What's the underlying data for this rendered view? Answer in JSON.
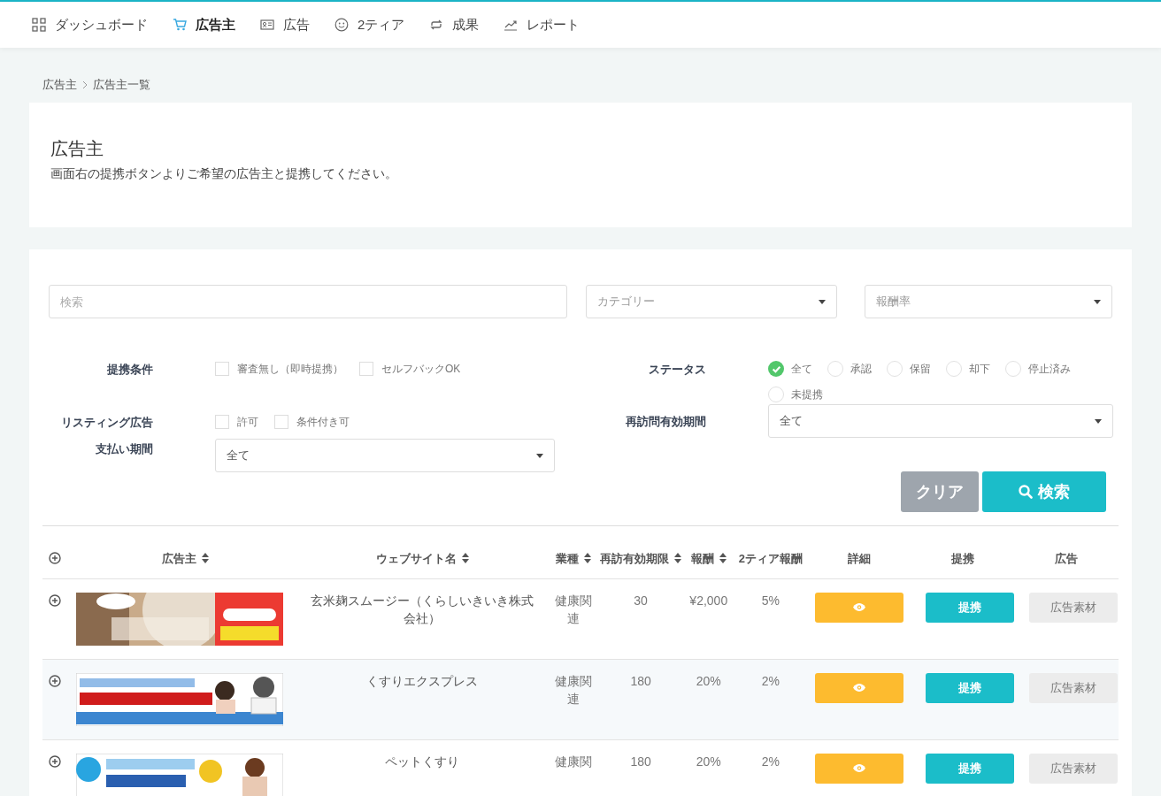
{
  "nav": [
    {
      "label": "ダッシュボード",
      "selected": false
    },
    {
      "label": "広告主",
      "selected": true
    },
    {
      "label": "広告",
      "selected": false
    },
    {
      "label": "2ティア",
      "selected": false
    },
    {
      "label": "成果",
      "selected": false
    },
    {
      "label": "レポート",
      "selected": false
    }
  ],
  "breadcrumb": [
    "広告主",
    "広告主一覧"
  ],
  "header": {
    "title": "広告主",
    "description": "画面右の提携ボタンよりご希望の広告主と提携してください。"
  },
  "filters": {
    "search": {
      "placeholder": "検索"
    },
    "category": {
      "placeholder": "カテゴリー"
    },
    "reward_rate": {
      "placeholder": "報酬率"
    },
    "conditions": {
      "label": "提携条件",
      "options": [
        {
          "label": "審査無し（即時提携）",
          "checked": false
        },
        {
          "label": "セルフバックOK",
          "checked": false
        }
      ]
    },
    "listing": {
      "label": "リスティング広告",
      "options": [
        {
          "label": "許可",
          "checked": false
        },
        {
          "label": "条件付き可",
          "checked": false
        }
      ]
    },
    "payment_period": {
      "label": "支払い期間",
      "value": "全て"
    },
    "status": {
      "label": "ステータス",
      "options": [
        {
          "label": "全て",
          "selected": true
        },
        {
          "label": "承認",
          "selected": false
        },
        {
          "label": "保留",
          "selected": false
        },
        {
          "label": "却下",
          "selected": false
        },
        {
          "label": "停止済み",
          "selected": false
        },
        {
          "label": "未提携",
          "selected": false
        }
      ]
    },
    "revisit_period": {
      "label": "再訪問有効期間",
      "value": "全て"
    },
    "buttons": {
      "clear": "クリア",
      "search": "検索"
    }
  },
  "table": {
    "columns": [
      {
        "label": "広告主",
        "sortable": true
      },
      {
        "label": "ウェブサイト名",
        "sortable": true
      },
      {
        "label": "業種",
        "sortable": true
      },
      {
        "label": "再訪有効期限",
        "sortable": true
      },
      {
        "label": "報酬",
        "sortable": true
      },
      {
        "label": "2ティア報酬",
        "sortable": false
      },
      {
        "label": "詳細",
        "sortable": false
      },
      {
        "label": "提携",
        "sortable": false
      },
      {
        "label": "広告",
        "sortable": false
      }
    ],
    "rows": [
      {
        "website": "玄米麹スムージー（くらしいきいき株式会社）",
        "industry": "健康関連",
        "revisit": "30",
        "reward": "¥2,000",
        "tier2": "5%",
        "partner_button": "提携",
        "ad_button": "広告素材"
      },
      {
        "website": "くすりエクスプレス",
        "industry": "健康関連",
        "revisit": "180",
        "reward": "20%",
        "tier2": "2%",
        "partner_button": "提携",
        "ad_button": "広告素材"
      },
      {
        "website": "ペットくすり",
        "industry": "健康関",
        "revisit": "180",
        "reward": "20%",
        "tier2": "2%",
        "partner_button": "提携",
        "ad_button": "広告素材"
      }
    ]
  }
}
